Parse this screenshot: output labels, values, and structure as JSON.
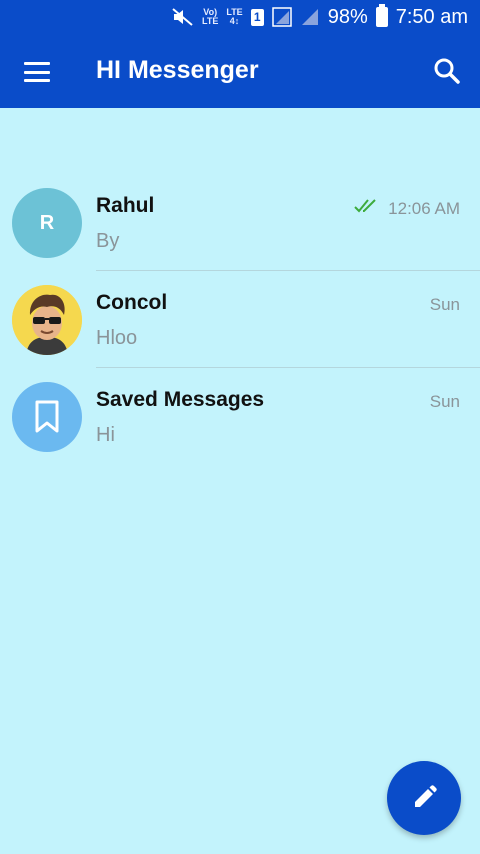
{
  "status_bar": {
    "volte_top": "Vo)",
    "volte_bottom": "LTE",
    "lte_top": "LTE",
    "lte_bottom": "4↕",
    "sim": "1",
    "battery": "98%",
    "time": "7:50 am"
  },
  "app_bar": {
    "title": "HI Messenger"
  },
  "chats": [
    {
      "name": "Rahul",
      "message": "By",
      "time": "12:06 AM",
      "avatar_initial": "R",
      "avatar_color": "#6cc2d6",
      "read": true
    },
    {
      "name": "Concol",
      "message": "Hloo",
      "time": "Sun",
      "avatar_color": "#f5d84e"
    },
    {
      "name": "Saved Messages",
      "message": "Hi",
      "time": "Sun",
      "avatar_color": "#6bb9f0",
      "avatar_icon": "bookmark-icon"
    }
  ],
  "colors": {
    "primary": "#0a4cc9",
    "background": "#c3f3fc",
    "read_check": "#3dab3d"
  },
  "icons": {
    "menu": "hamburger-menu-icon",
    "search": "search-icon",
    "compose": "pencil-icon"
  }
}
